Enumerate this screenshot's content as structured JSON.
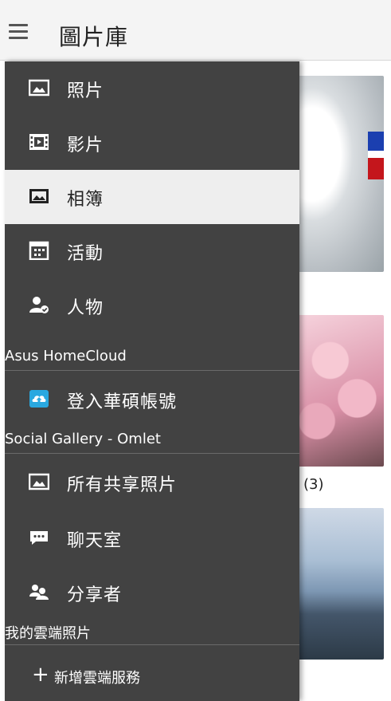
{
  "app_bar": {
    "title": "圖片庫"
  },
  "drawer": {
    "items": [
      {
        "label": "照片",
        "icon": "photo-icon"
      },
      {
        "label": "影片",
        "icon": "film-icon"
      },
      {
        "label": "相簿",
        "icon": "album-icon",
        "selected": true
      },
      {
        "label": "活動",
        "icon": "calendar-icon"
      },
      {
        "label": "人物",
        "icon": "person-check-icon"
      }
    ],
    "asus_section": {
      "header": "Asus HomeCloud",
      "items": [
        {
          "label": "登入華碩帳號",
          "icon": "cloud-login-icon",
          "color": "#29a8e0"
        }
      ]
    },
    "social_section": {
      "header": "Social Gallery - Omlet",
      "items": [
        {
          "label": "所有共享照片",
          "icon": "photo-icon"
        },
        {
          "label": "聊天室",
          "icon": "chat-icon"
        },
        {
          "label": "分享者",
          "icon": "people-icon"
        }
      ]
    },
    "cloud_section": {
      "header": "我的雲端照片",
      "add_label": "新增雲端服務",
      "add_icon": "plus-icon"
    }
  },
  "background": {
    "album_count": "(3)"
  },
  "colors": {
    "drawer_bg": "#424242",
    "selected_bg": "#eeeeee",
    "appbar_bg": "#f4f4f4",
    "accent": "#29a8e0"
  }
}
